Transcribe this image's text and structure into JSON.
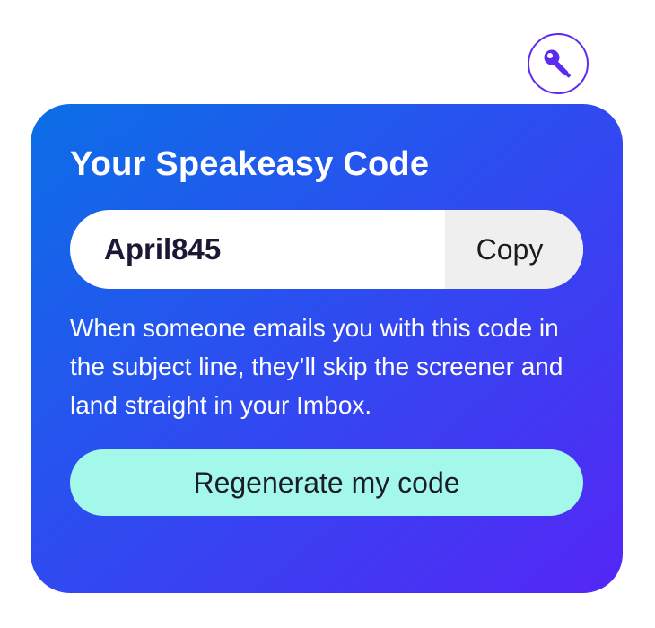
{
  "icons": {
    "key_badge": "key-icon"
  },
  "colors": {
    "gradient_start": "#0b6fe6",
    "gradient_end": "#5526f5",
    "key_accent": "#5b2bf0",
    "regenerate_button": "#a3f8ea",
    "copy_button_bg": "#f0efef"
  },
  "card": {
    "title": "Your Speakeasy Code",
    "code_value": "April845",
    "copy_label": "Copy",
    "description": "When someone emails you with this code in the subject line, they’ll skip the screener and land straight in your Imbox.",
    "regenerate_label": "Regenerate my code"
  }
}
